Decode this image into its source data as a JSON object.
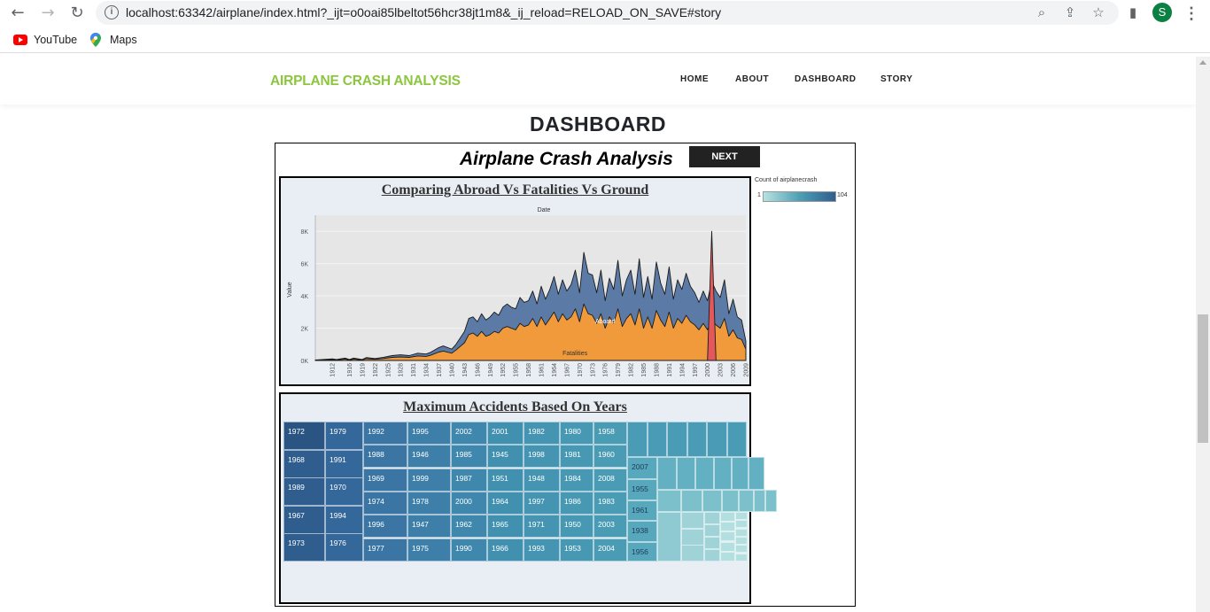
{
  "browser": {
    "url": "localhost:63342/airplane/index.html?_ijt=o0oai85lbeltot56hcr38jt1m8&_ij_reload=RELOAD_ON_SAVE#story",
    "profile_initial": "S",
    "bookmarks": [
      "YouTube",
      "Maps"
    ]
  },
  "site": {
    "brand": "AIRPLANE CRASH ANALYSIS",
    "nav": [
      "HOME",
      "ABOUT",
      "DASHBOARD",
      "STORY"
    ],
    "section_title": "DASHBOARD"
  },
  "story": {
    "title": "Airplane Crash Analysis",
    "next_label": "NEXT",
    "legend": {
      "title": "Count of airplanecrash",
      "min": "1",
      "max": "104"
    }
  },
  "chart_data": [
    {
      "type": "area",
      "title": "Comparing Abroad Vs Fatalities Vs Ground",
      "subtitle": "Date",
      "ylabel": "Value",
      "ylim": [
        0,
        9000
      ],
      "y_ticks": [
        "0K",
        "2K",
        "4K",
        "6K",
        "8K"
      ],
      "x_ticks": [
        "1912",
        "1916",
        "1919",
        "1922",
        "1925",
        "1928",
        "1931",
        "1934",
        "1937",
        "1940",
        "1943",
        "1946",
        "1949",
        "1952",
        "1955",
        "1958",
        "1961",
        "1964",
        "1967",
        "1970",
        "1973",
        "1976",
        "1979",
        "1982",
        "1985",
        "1988",
        "1991",
        "1994",
        "1997",
        "2000",
        "2003",
        "2006",
        "2009"
      ],
      "x": [
        1908,
        1912,
        1913,
        1915,
        1916,
        1917,
        1919,
        1920,
        1922,
        1924,
        1926,
        1928,
        1930,
        1932,
        1934,
        1935,
        1937,
        1938,
        1940,
        1941,
        1943,
        1944,
        1945,
        1946,
        1947,
        1948,
        1949,
        1950,
        1951,
        1952,
        1953,
        1954,
        1955,
        1956,
        1957,
        1958,
        1959,
        1960,
        1961,
        1962,
        1963,
        1964,
        1965,
        1966,
        1967,
        1968,
        1969,
        1970,
        1971,
        1972,
        1973,
        1974,
        1975,
        1976,
        1977,
        1978,
        1979,
        1980,
        1981,
        1982,
        1983,
        1984,
        1985,
        1986,
        1987,
        1988,
        1989,
        1990,
        1991,
        1992,
        1993,
        1994,
        1995,
        1996,
        1997,
        1998,
        1999,
        2000,
        2001,
        2002,
        2003,
        2004,
        2005,
        2006,
        2007,
        2008,
        2009
      ],
      "series": [
        {
          "name": "Aboard",
          "color": "#5b7ba6",
          "values": [
            30,
            100,
            60,
            150,
            60,
            150,
            60,
            180,
            120,
            200,
            300,
            350,
            300,
            450,
            400,
            500,
            800,
            900,
            700,
            1000,
            1800,
            2600,
            2700,
            2400,
            2900,
            2500,
            2700,
            3000,
            2800,
            3300,
            3500,
            3300,
            3200,
            3900,
            3600,
            3700,
            4300,
            3500,
            4600,
            3800,
            4400,
            5200,
            4100,
            5000,
            4300,
            4700,
            5600,
            4200,
            6700,
            5400,
            5300,
            4200,
            5600,
            3700,
            5100,
            4400,
            6200,
            4000,
            5000,
            5600,
            4100,
            6300,
            3900,
            5200,
            3800,
            6100,
            4800,
            4100,
            5800,
            3800,
            5000,
            4400,
            5400,
            4600,
            4200,
            3600,
            4300,
            3700,
            4900,
            4300,
            3900,
            5000,
            2900,
            3800,
            2700,
            2500,
            1200
          ]
        },
        {
          "name": "Fatalities",
          "color": "#f09a3c",
          "values": [
            10,
            60,
            30,
            90,
            30,
            90,
            30,
            110,
            70,
            120,
            190,
            220,
            190,
            280,
            250,
            320,
            520,
            580,
            450,
            650,
            1100,
            1600,
            1700,
            1500,
            1800,
            1500,
            1600,
            1800,
            1700,
            2000,
            2100,
            2000,
            1900,
            2300,
            2100,
            2200,
            2600,
            2100,
            2700,
            2200,
            2600,
            3000,
            2400,
            2900,
            2500,
            2700,
            3200,
            2400,
            3500,
            2900,
            2800,
            2300,
            2900,
            2000,
            2700,
            2300,
            3200,
            2100,
            2600,
            2900,
            2200,
            3200,
            2000,
            2700,
            2000,
            3100,
            2500,
            2100,
            3000,
            2000,
            2600,
            2300,
            2800,
            2400,
            2200,
            1900,
            2300,
            1900,
            2500,
            2200,
            2000,
            2600,
            1500,
            1900,
            1400,
            1300,
            700
          ]
        },
        {
          "name": "Ground",
          "color": "#e4585b",
          "values": [
            0,
            0,
            0,
            0,
            0,
            0,
            0,
            0,
            0,
            0,
            0,
            0,
            0,
            0,
            0,
            0,
            0,
            0,
            0,
            0,
            0,
            0,
            0,
            0,
            0,
            0,
            0,
            0,
            0,
            0,
            0,
            0,
            0,
            0,
            0,
            0,
            0,
            0,
            0,
            0,
            0,
            0,
            0,
            0,
            0,
            0,
            0,
            0,
            0,
            0,
            0,
            0,
            0,
            0,
            0,
            0,
            0,
            0,
            0,
            0,
            0,
            0,
            0,
            0,
            0,
            0,
            0,
            0,
            0,
            0,
            0,
            0,
            0,
            0,
            0,
            0,
            0,
            0,
            8000,
            0,
            0,
            0,
            0,
            0,
            0,
            0,
            0
          ]
        }
      ],
      "annotations": [
        "Aboard",
        "Fatalities"
      ]
    },
    {
      "type": "heatmap",
      "title": "Maximum Accidents Based On Years",
      "columns": [
        [
          "1972",
          "1968",
          "1989",
          "1967",
          "1973"
        ],
        [
          "1979",
          "1991",
          "1970",
          "1994",
          "1976"
        ],
        [
          "1992",
          "1988",
          "1969",
          "1974",
          "1996",
          "1977"
        ],
        [
          "1995",
          "1946",
          "1999",
          "1978",
          "1947",
          "1975"
        ],
        [
          "2002",
          "1985",
          "1987",
          "2000",
          "1962",
          "1990"
        ],
        [
          "2001",
          "1945",
          "1951",
          "1964",
          "1965",
          "1966"
        ],
        [
          "1982",
          "1998",
          "1948",
          "1997",
          "1971",
          "1993"
        ],
        [
          "1980",
          "1981",
          "1984",
          "1986",
          "1950",
          "1953"
        ],
        [
          "1958",
          "1960",
          "2008",
          "1983",
          "2003",
          "2004"
        ]
      ],
      "small_labels": [
        "2007",
        "1955",
        "1961",
        "1938",
        "1956"
      ]
    }
  ]
}
